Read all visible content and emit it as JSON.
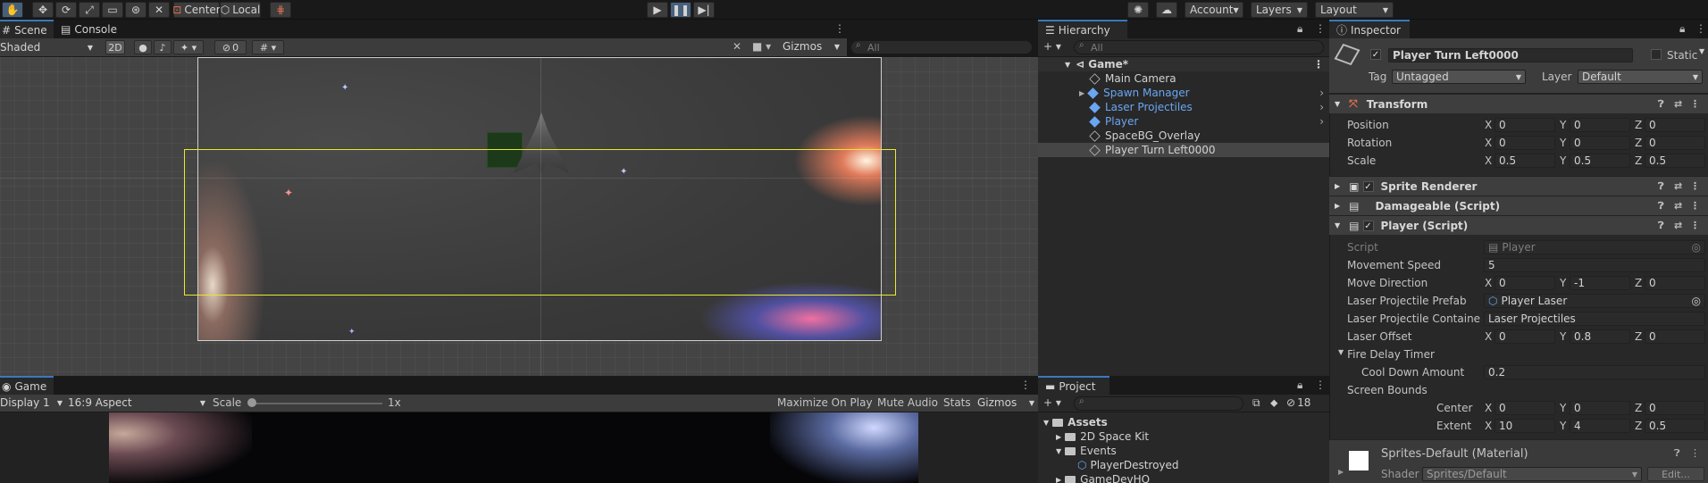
{
  "toolbar": {
    "center_label": "Center",
    "local_label": "Local",
    "account_label": "Account",
    "layers_label": "Layers",
    "layout_label": "Layout"
  },
  "scene": {
    "tab_scene": "Scene",
    "tab_console": "Console",
    "shading_mode": "Shaded",
    "btn_2d": "2D",
    "hidden_count": "0",
    "gizmos_label": "Gizmos",
    "search_placeholder": "All"
  },
  "game": {
    "tab_label": "Game",
    "display": "Display 1",
    "aspect": "16:9 Aspect",
    "scale_label": "Scale",
    "scale_value": "1x",
    "maximize_on_play": "Maximize On Play",
    "mute_audio": "Mute Audio",
    "stats": "Stats",
    "gizmos_label": "Gizmos"
  },
  "hierarchy": {
    "tab_label": "Hierarchy",
    "search_placeholder": "All",
    "items": [
      {
        "label": "Game*",
        "prefab": false
      },
      {
        "label": "Main Camera",
        "prefab": false
      },
      {
        "label": "Spawn Manager",
        "prefab": true
      },
      {
        "label": "Laser Projectiles",
        "prefab": true
      },
      {
        "label": "Player",
        "prefab": true
      },
      {
        "label": "SpaceBG_Overlay",
        "prefab": false
      },
      {
        "label": "Player Turn Left0000",
        "prefab": false
      }
    ]
  },
  "project": {
    "tab_label": "Project",
    "hidden_count": "18",
    "items": [
      {
        "label": "Assets"
      },
      {
        "label": "2D Space Kit"
      },
      {
        "label": "Events"
      },
      {
        "label": "PlayerDestroyed"
      },
      {
        "label": "GameDevHQ"
      }
    ]
  },
  "inspector": {
    "tab_label": "Inspector",
    "object_name": "Player Turn Left0000",
    "static_label": "Static",
    "tag_label": "Tag",
    "tag_value": "Untagged",
    "layer_label": "Layer",
    "layer_value": "Default",
    "transform": {
      "title": "Transform",
      "position_label": "Position",
      "rotation_label": "Rotation",
      "scale_label": "Scale",
      "position": {
        "x": "0",
        "y": "0",
        "z": "0"
      },
      "rotation": {
        "x": "0",
        "y": "0",
        "z": "0"
      },
      "scale": {
        "x": "0.5",
        "y": "0.5",
        "z": "0.5"
      }
    },
    "sprite_renderer": "Sprite Renderer",
    "damageable": "Damageable (Script)",
    "player_script": {
      "title": "Player (Script)",
      "script_label": "Script",
      "script_value": "Player",
      "movement_speed_label": "Movement Speed",
      "movement_speed": "5",
      "move_direction_label": "Move Direction",
      "move_direction": {
        "x": "0",
        "y": "-1",
        "z": "0"
      },
      "laser_prefab_label": "Laser Projectile Prefab",
      "laser_prefab": "Player Laser",
      "laser_container_label": "Laser Projectile Container (",
      "laser_container": "Laser Projectiles",
      "laser_offset_label": "Laser Offset",
      "laser_offset": {
        "x": "0",
        "y": "0.8",
        "z": "0"
      },
      "fire_delay_label": "Fire Delay Timer",
      "cooldown_label": "Cool Down Amount",
      "cooldown": "0.2",
      "screen_bounds_label": "Screen Bounds",
      "center_label": "Center",
      "center": {
        "x": "0",
        "y": "0",
        "z": "0"
      },
      "extent_label": "Extent",
      "extent": {
        "x": "10",
        "y": "4",
        "z": "0.5"
      }
    },
    "material": {
      "title": "Sprites-Default (Material)",
      "shader_label": "Shader",
      "shader_value": "Sprites/Default",
      "edit_label": "Edit..."
    }
  },
  "axes": {
    "x": "X",
    "y": "Y",
    "z": "Z"
  },
  "colors": {
    "accent": "#3a79bb",
    "selection_yellow": "#e8e82c",
    "prefab_blue": "#6aa6f1"
  }
}
